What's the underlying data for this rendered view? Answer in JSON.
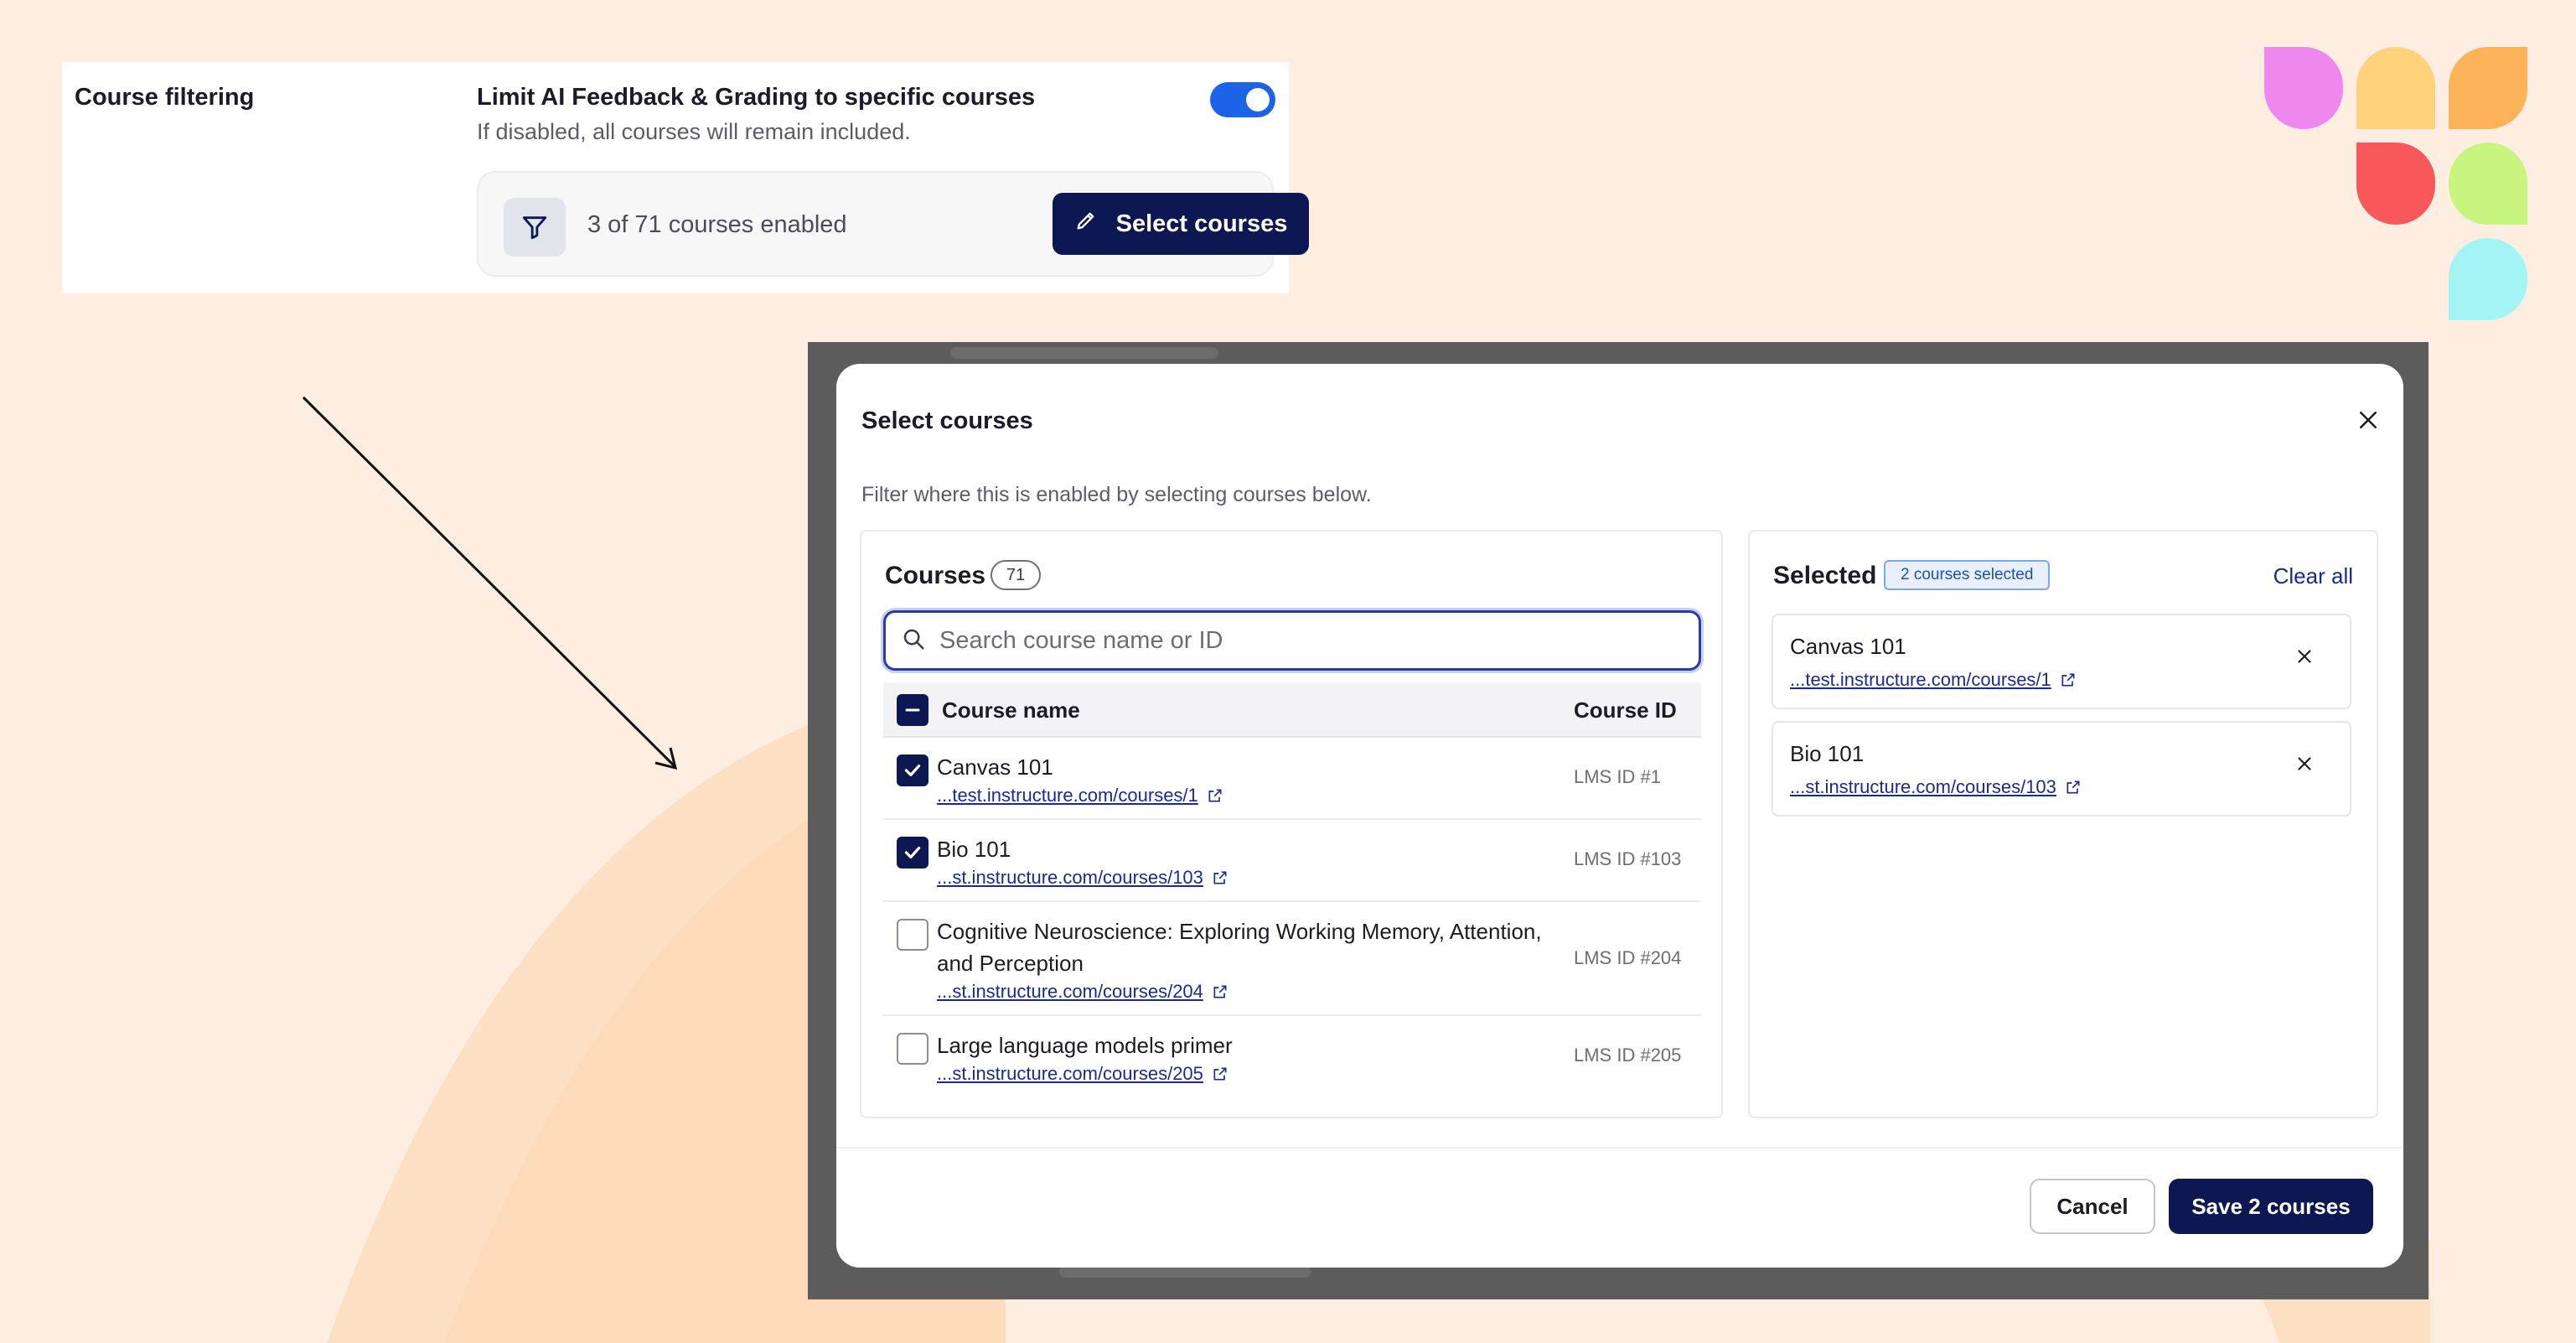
{
  "settings": {
    "section_label": "Course filtering",
    "setting_title": "Limit AI Feedback & Grading to specific courses",
    "setting_subtitle": "If disabled, all courses will remain included.",
    "toggle_on": true,
    "courses_enabled_text": "3 of 71 courses enabled",
    "select_courses_label": "Select courses"
  },
  "modal": {
    "title": "Select courses",
    "description": "Filter where this is enabled by selecting courses below.",
    "courses_panel": {
      "heading": "Courses",
      "count": "71",
      "search_placeholder": "Search course name or ID",
      "col_name": "Course name",
      "col_id": "Course ID",
      "rows": [
        {
          "name": "Canvas 101",
          "link": "...test.instructure.com/courses/1",
          "lms_id": "LMS ID #1",
          "checked": true
        },
        {
          "name": "Bio 101",
          "link": "...st.instructure.com/courses/103",
          "lms_id": "LMS ID #103",
          "checked": true
        },
        {
          "name": "Cognitive Neuroscience: Exploring Working Memory, Attention, and Perception",
          "link": "...st.instructure.com/courses/204",
          "lms_id": "LMS ID #204",
          "checked": false
        },
        {
          "name": "Large language models primer",
          "link": "...st.instructure.com/courses/205",
          "lms_id": "LMS ID #205",
          "checked": false
        }
      ]
    },
    "selected_panel": {
      "heading": "Selected",
      "badge": "2 courses selected",
      "clear_all": "Clear all",
      "items": [
        {
          "name": "Canvas 101",
          "link": "...test.instructure.com/courses/1"
        },
        {
          "name": "Bio 101",
          "link": "...st.instructure.com/courses/103"
        }
      ]
    },
    "footer": {
      "cancel_label": "Cancel",
      "save_label": "Save 2 courses"
    }
  },
  "colors": {
    "background": "#fdeee1",
    "primary_navy": "#0d1752",
    "toggle_blue": "#1d63e8",
    "link_blue": "#1b2a8f",
    "logo_pink": "#ee88ee",
    "logo_yellow": "#fdd27a",
    "logo_orange": "#fdb35a",
    "logo_red": "#f9585a",
    "logo_green": "#c8f580",
    "logo_cyan": "#a4f4f6"
  }
}
